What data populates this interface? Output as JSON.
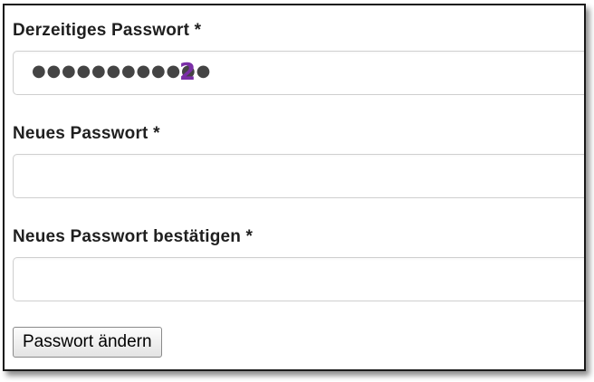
{
  "form": {
    "current_password": {
      "label": "Derzeitiges Passwort *",
      "masked_value": "●●●●●●●●●●●●",
      "step_marker": "2"
    },
    "new_password": {
      "label": "Neues Passwort *",
      "value": ""
    },
    "confirm_password": {
      "label": "Neues Passwort bestätigen *",
      "value": ""
    },
    "submit_label": "Passwort ändern"
  },
  "colors": {
    "step_marker": "#7a2fa6",
    "label_text": "#1f1f1f",
    "field_border": "#cfcfcf"
  }
}
